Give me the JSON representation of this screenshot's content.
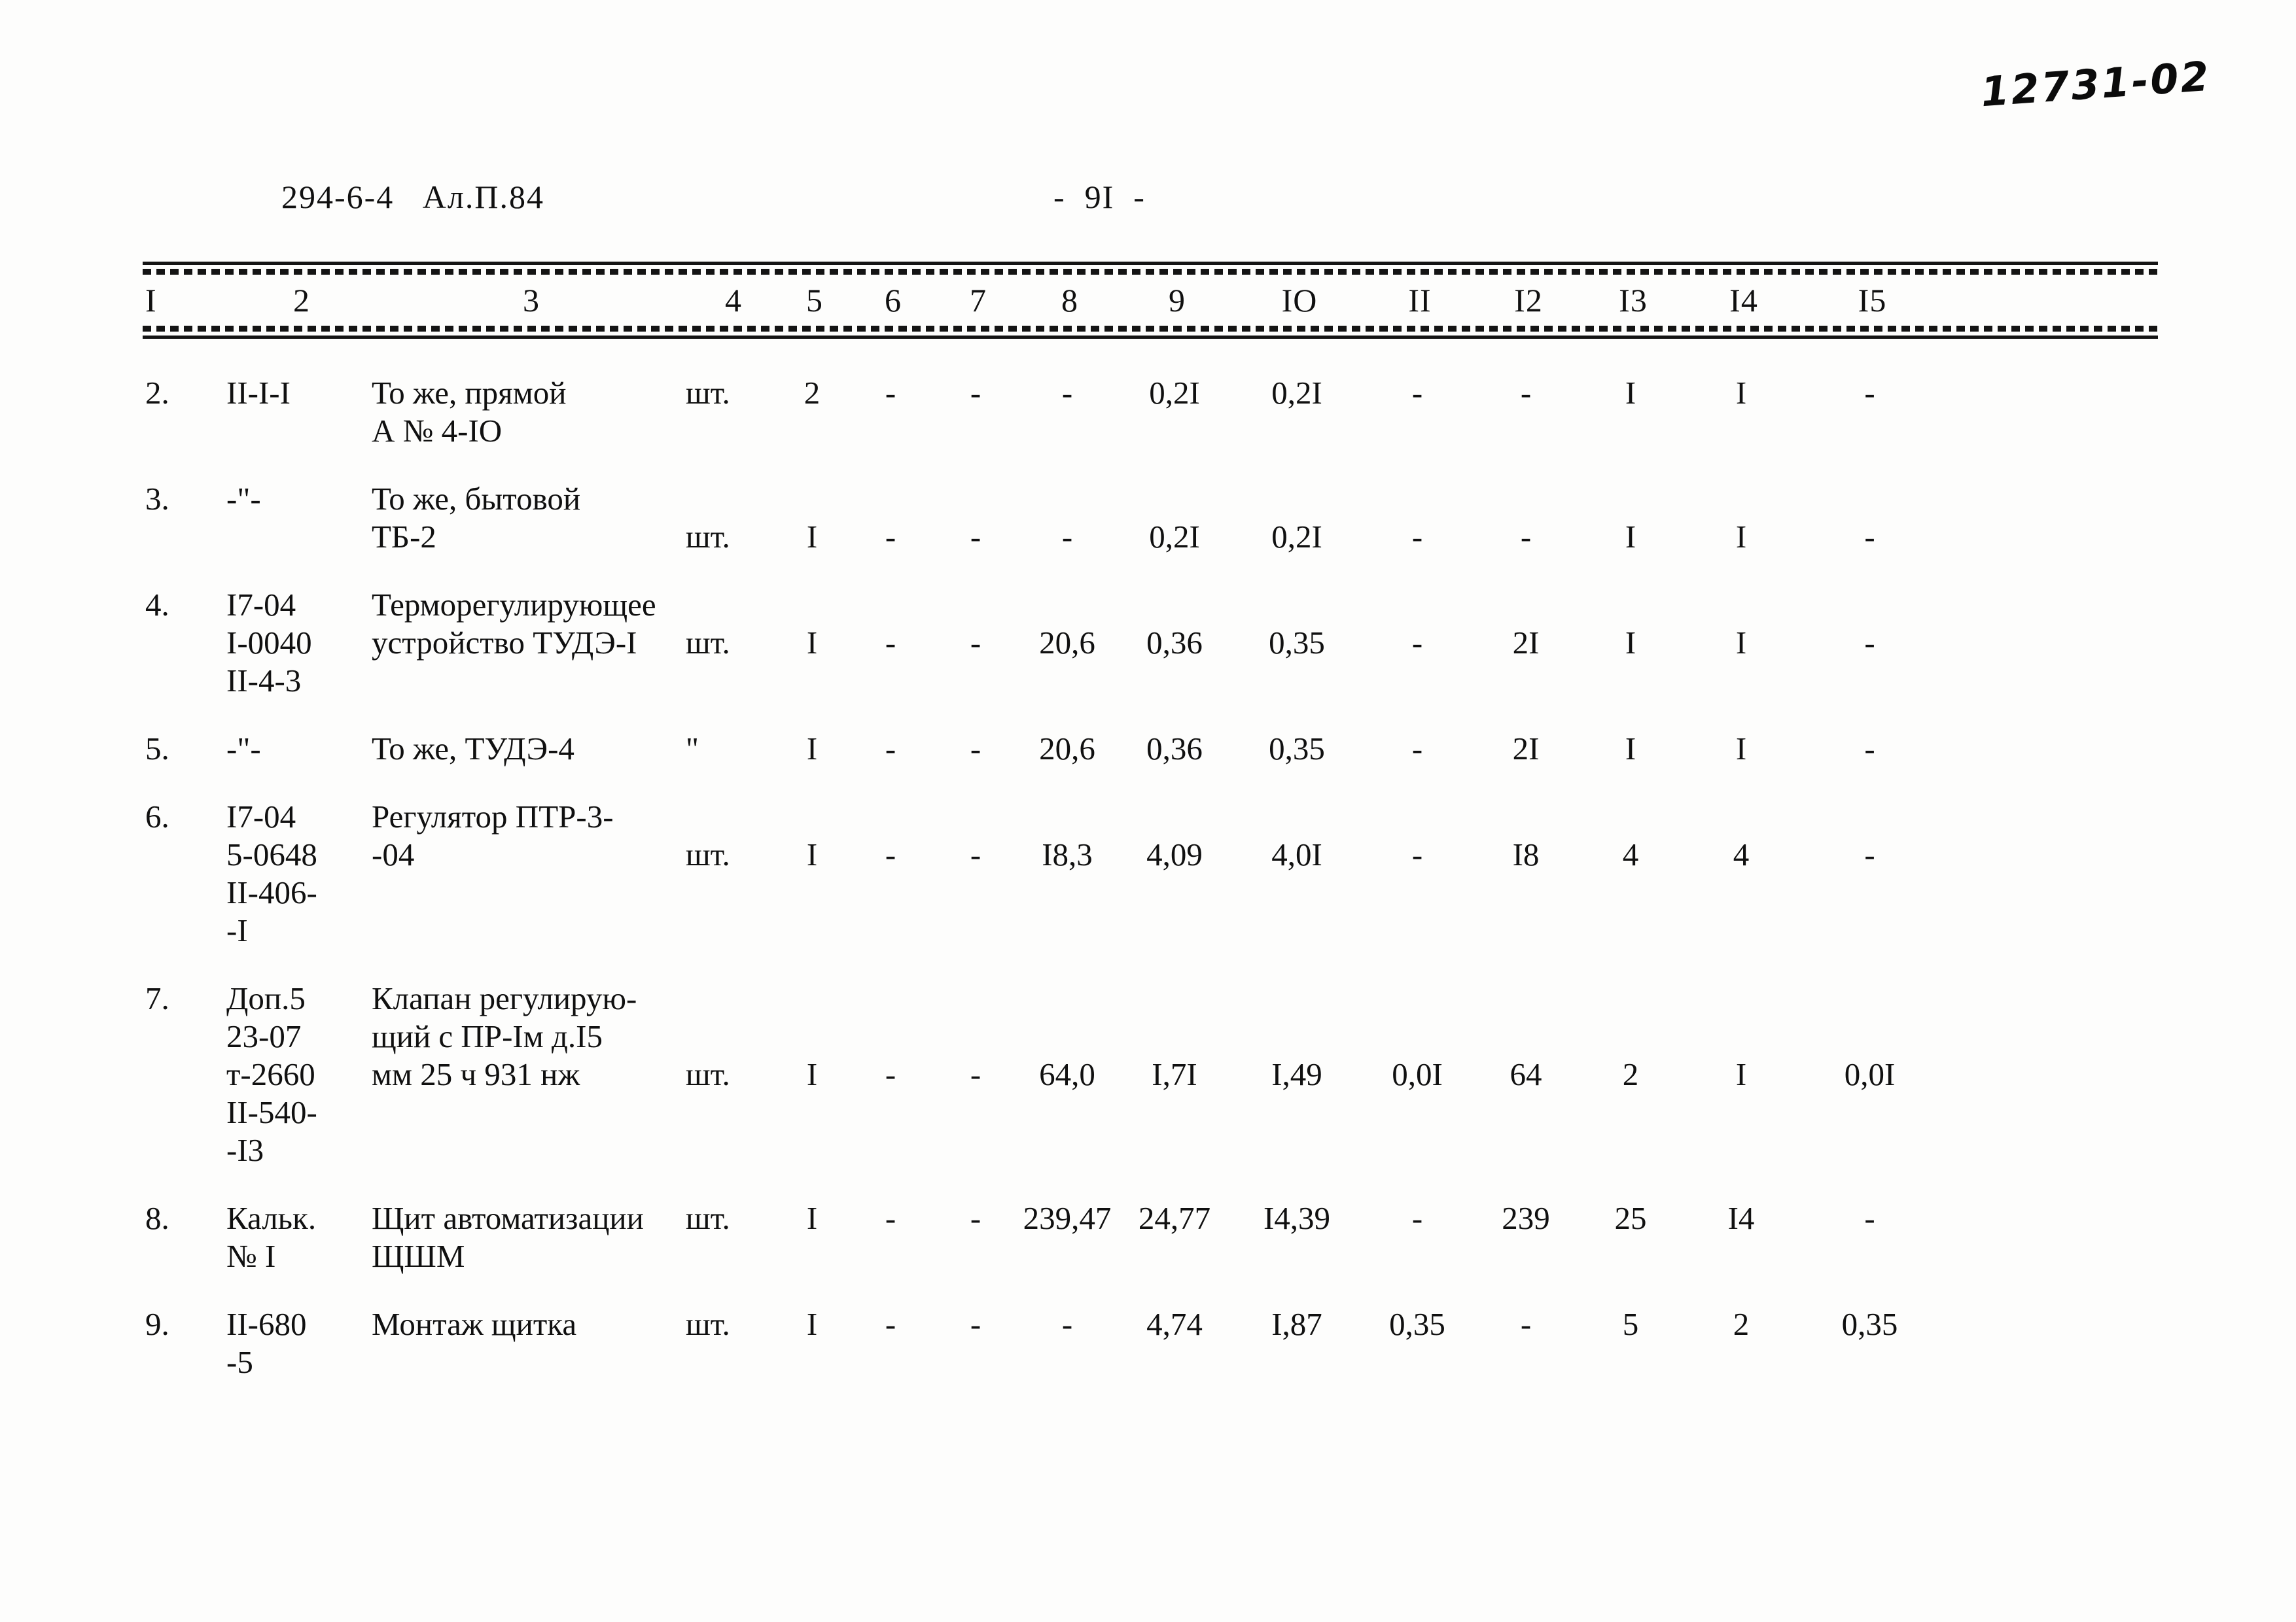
{
  "stamp": "12731-02",
  "header": {
    "album": "294-6-4   Ал.П.84",
    "page_number": "-  9I  -"
  },
  "table": {
    "column_numbers": [
      "I",
      "2",
      "3",
      "4",
      "5",
      "6",
      "7",
      "8",
      "9",
      "IO",
      "II",
      "I2",
      "I3",
      "I4",
      "I5"
    ],
    "rows": [
      {
        "no": "2.",
        "code": "II-I-I",
        "name_line1": "То же, прямой",
        "name_line2": "А № 4-IO",
        "unit": "шт.",
        "c5": "2",
        "c6": "-",
        "c7": "-",
        "c8": "-",
        "c9": "0,2I",
        "c10": "0,2I",
        "c11": "-",
        "c12": "-",
        "c13": "I",
        "c14": "I",
        "c15": "-"
      },
      {
        "no": "3.",
        "code": "-\"-",
        "name_line1": "То же, бытовой",
        "name_line2": "ТБ-2",
        "unit": "шт.",
        "c5": "I",
        "c6": "-",
        "c7": "-",
        "c8": "-",
        "c9": "0,2I",
        "c10": "0,2I",
        "c11": "-",
        "c12": "-",
        "c13": "I",
        "c14": "I",
        "c15": "-"
      },
      {
        "no": "4.",
        "code": "I7-04",
        "code_line2": "I-0040",
        "code_line3": "II-4-3",
        "name_line1": "Терморегулирующее",
        "name_line2": "устройство ТУДЭ-I",
        "unit": "шт.",
        "c5": "I",
        "c6": "-",
        "c7": "-",
        "c8": "20,6",
        "c9": "0,36",
        "c10": "0,35",
        "c11": "-",
        "c12": "2I",
        "c13": "I",
        "c14": "I",
        "c15": "-"
      },
      {
        "no": "5.",
        "code": "-\"-",
        "name_line1": "То же, ТУДЭ-4",
        "unit": "\"",
        "c5": "I",
        "c6": "-",
        "c7": "-",
        "c8": "20,6",
        "c9": "0,36",
        "c10": "0,35",
        "c11": "-",
        "c12": "2I",
        "c13": "I",
        "c14": "I",
        "c15": "-"
      },
      {
        "no": "6.",
        "code": "I7-04",
        "code_line2": "5-0648",
        "code_line3": "II-406-",
        "code_line4": "-I",
        "name_line1": "Регулятор ПТР-3-",
        "name_line2": "-04",
        "unit": "шт.",
        "c5": "I",
        "c6": "-",
        "c7": "-",
        "c8": "I8,3",
        "c9": "4,09",
        "c10": "4,0I",
        "c11": "-",
        "c12": "I8",
        "c13": "4",
        "c14": "4",
        "c15": "-"
      },
      {
        "no": "7.",
        "code": "Доп.5",
        "code_line2": "23-07",
        "code_line3": "т-2660",
        "code_line4": "II-540-",
        "code_line5": "-I3",
        "name_line1": "Клапан регулирую-",
        "name_line2": "щий с ПР-Iм д.I5",
        "name_line3": "мм 25 ч 931 нж",
        "unit": "шт.",
        "c5": "I",
        "c6": "-",
        "c7": "-",
        "c8": "64,0",
        "c9": "I,7I",
        "c10": "I,49",
        "c11": "0,0I",
        "c12": "64",
        "c13": "2",
        "c14": "I",
        "c15": "0,0I"
      },
      {
        "no": "8.",
        "code": "Кальк.",
        "code_line2": "№ I",
        "name_line1": "Щит автоматизации",
        "name_line2": "ЩШМ",
        "unit": "шт.",
        "c5": "I",
        "c6": "-",
        "c7": "-",
        "c8": "239,47",
        "c9": "24,77",
        "c10": "I4,39",
        "c11": "-",
        "c12": "239",
        "c13": "25",
        "c14": "I4",
        "c15": "-"
      },
      {
        "no": "9.",
        "code": "II-680",
        "code_line2": "-5",
        "name_line1": "Монтаж щитка",
        "unit": "шт.",
        "c5": "I",
        "c6": "-",
        "c7": "-",
        "c8": "-",
        "c9": "4,74",
        "c10": "I,87",
        "c11": "0,35",
        "c12": "-",
        "c13": "5",
        "c14": "2",
        "c15": "0,35"
      }
    ]
  }
}
